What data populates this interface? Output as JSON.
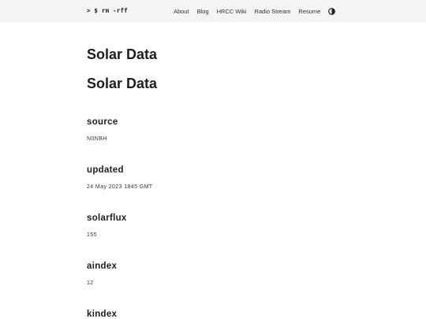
{
  "header": {
    "logo": "> $ rm -rff",
    "nav": [
      "About",
      "Blog",
      "HRCC Wiki",
      "Radio Stream",
      "Resume"
    ],
    "theme_toggle_icon": "half-circle-contrast-icon"
  },
  "main": {
    "title": "Solar Data",
    "subtitle": "Solar Data",
    "fields": [
      {
        "label": "source",
        "value": "N0NBH"
      },
      {
        "label": "updated",
        "value": "24 May 2023 1845 GMT"
      },
      {
        "label": "solarflux",
        "value": "155"
      },
      {
        "label": "aindex",
        "value": "12"
      },
      {
        "label": "kindex",
        "value": ""
      }
    ]
  }
}
